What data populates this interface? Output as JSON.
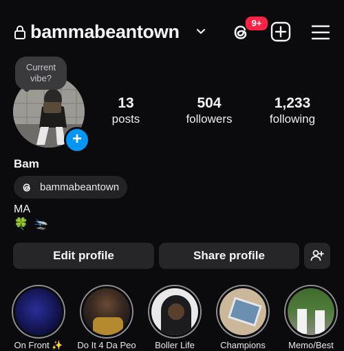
{
  "header": {
    "username": "bammabeantown",
    "notification_badge": "9+"
  },
  "profile": {
    "vibe_prompt": "Current vibe?",
    "name": "Bam",
    "threads_handle": "bammabeantown",
    "bio": "MA",
    "emojis": [
      "🍀",
      "🛬"
    ]
  },
  "stats": [
    {
      "value": "13",
      "label": "posts"
    },
    {
      "value": "504",
      "label": "followers"
    },
    {
      "value": "1,233",
      "label": "following"
    }
  ],
  "actions": {
    "edit_label": "Edit profile",
    "share_label": "Share profile"
  },
  "highlights": [
    {
      "label": "On Front ✨",
      "thumb": "dark-blue"
    },
    {
      "label": "Do It 4 Da Peo",
      "thumb": "portrait"
    },
    {
      "label": "Boller Life",
      "thumb": "hoodie"
    },
    {
      "label": "Champions",
      "thumb": "frame"
    },
    {
      "label": "Memo/Best",
      "thumb": "group"
    }
  ],
  "colors": {
    "background": "#0b0b0d",
    "accent_blue": "#0095f6",
    "badge_red": "#ff2146",
    "button_bg": "#262629"
  }
}
